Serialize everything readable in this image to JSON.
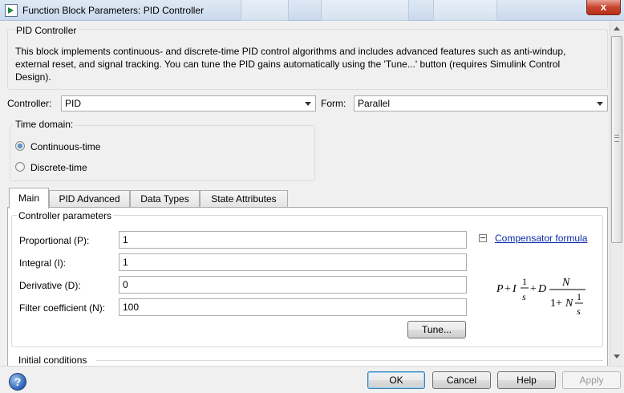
{
  "window": {
    "title": "Function Block Parameters: PID Controller",
    "close_glyph": "x"
  },
  "description": {
    "group_title": "PID Controller",
    "text": "This block implements continuous- and discrete-time PID control algorithms and includes advanced features such as anti-windup, external reset, and signal tracking. You can tune the PID gains automatically using the 'Tune...' button (requires Simulink Control Design)."
  },
  "controller": {
    "label": "Controller:",
    "value": "PID"
  },
  "form": {
    "label": "Form:",
    "value": "Parallel"
  },
  "time_domain": {
    "group_title": "Time domain:",
    "options": [
      {
        "label": "Continuous-time",
        "selected": true
      },
      {
        "label": "Discrete-time",
        "selected": false
      }
    ]
  },
  "tabs": [
    {
      "label": "Main",
      "active": true
    },
    {
      "label": "PID Advanced",
      "active": false
    },
    {
      "label": "Data Types",
      "active": false
    },
    {
      "label": "State Attributes",
      "active": false
    }
  ],
  "controller_parameters": {
    "group_title": "Controller parameters",
    "fields": [
      {
        "label": "Proportional (P):",
        "value": "1"
      },
      {
        "label": "Integral (I):",
        "value": "1"
      },
      {
        "label": "Derivative (D):",
        "value": "0"
      },
      {
        "label": "Filter coefficient (N):",
        "value": "100"
      }
    ],
    "tune_label": "Tune...",
    "formula_link": "Compensator formula",
    "formula": {
      "p": "P",
      "plus1": "+",
      "i": "I",
      "one_a": "1",
      "s_a": "s",
      "plus2": "+",
      "d": "D",
      "n_num": "N",
      "den_one": "1+",
      "den_n": "N",
      "one_b": "1",
      "s_b": "s"
    }
  },
  "initial_conditions": {
    "group_title": "Initial conditions"
  },
  "buttons": {
    "help_glyph": "?",
    "ok": "OK",
    "cancel": "Cancel",
    "help": "Help",
    "apply": "Apply"
  },
  "colors": {
    "link": "#0b2ba8",
    "radio_selected": "#1f5aa0",
    "ok_border": "#3c7fb1"
  }
}
